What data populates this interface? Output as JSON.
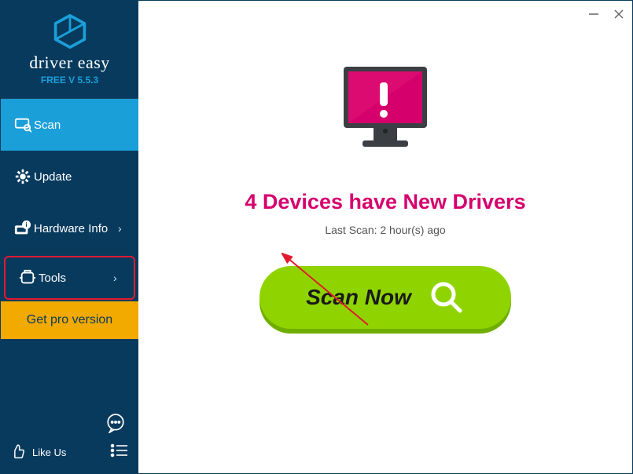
{
  "brand": {
    "name": "driver easy",
    "version": "FREE V 5.5.3"
  },
  "sidebar": {
    "items": [
      {
        "label": "Scan"
      },
      {
        "label": "Update"
      },
      {
        "label": "Hardware Info"
      },
      {
        "label": "Tools"
      }
    ],
    "get_pro_label": "Get pro version",
    "like_us_label": "Like Us"
  },
  "main": {
    "headline": "4 Devices have New Drivers",
    "last_scan": "Last Scan: 2 hour(s) ago",
    "scan_button": "Scan Now"
  },
  "colors": {
    "sidebar_bg": "#083a5e",
    "accent_blue": "#1a9fd9",
    "accent_orange": "#f2a900",
    "scan_green": "#8fd400",
    "headline_pink": "#d6006d",
    "monitor_pink": "#d6006d",
    "highlight_red": "#e11a2f"
  }
}
